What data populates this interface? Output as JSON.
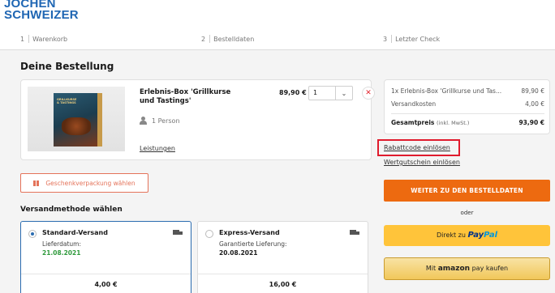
{
  "brand": {
    "logo_line1": "JOCHEN",
    "logo_line2": "SCHWEIZER"
  },
  "steps": [
    {
      "num": "1",
      "label": "Warenkorb"
    },
    {
      "num": "2",
      "label": "Bestelldaten"
    },
    {
      "num": "3",
      "label": "Letzter Check"
    }
  ],
  "order": {
    "title": "Deine Bestellung",
    "product": {
      "image_label": "GRILLKURSE & TASTINGS",
      "name": "Erlebnis-Box 'Grillkurse und Tastings'",
      "persons": "1 Person",
      "details_link": "Leistungen",
      "price": "89,90 €",
      "quantity": "1",
      "qty_chevron": "⌄",
      "remove_icon": "✕"
    },
    "gift_button": "Geschenkverpackung wählen"
  },
  "shipping": {
    "title": "Versandmethode wählen",
    "options": [
      {
        "name": "Standard-Versand",
        "sub": "Lieferdatum:",
        "date": "21.08.2021",
        "price": "4,00 €",
        "selected": true
      },
      {
        "name": "Express-Versand",
        "sub": "Garantierte Lieferung:",
        "date": "20.08.2021",
        "price": "16,00 €",
        "selected": false
      }
    ]
  },
  "summary": {
    "item_label": "1x Erlebnis-Box 'Grillkurse und Tas...",
    "item_price": "89,90 €",
    "shipping_label": "Versandkosten",
    "shipping_price": "4,00 €",
    "total_label": "Gesamtpreis",
    "total_note": "(inkl. MwSt.)",
    "total_price": "93,90 €"
  },
  "links": {
    "coupon": "Rabattcode einlösen",
    "voucher": "Wertgutschein einlösen"
  },
  "actions": {
    "continue": "WEITER ZU DEN BESTELLDATEN",
    "or": "oder",
    "paypal_prefix": "Direkt zu",
    "paypal_brand1": "Pay",
    "paypal_brand2": "Pal",
    "amazon_prefix": "Mit",
    "amazon_brand": "amazon",
    "amazon_suffix": "pay kaufen"
  },
  "colors": {
    "brand_blue": "#1f66b3",
    "cta_orange": "#ed6a10",
    "paypal_yellow": "#ffc43a",
    "highlight_red": "#e01b2d",
    "date_green": "#2f9a3c"
  }
}
